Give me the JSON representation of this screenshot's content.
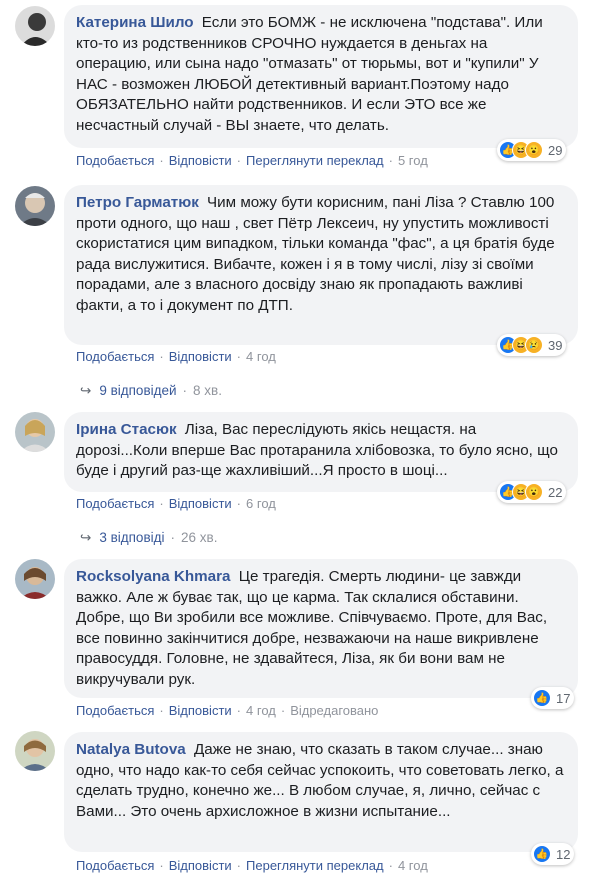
{
  "comments": [
    {
      "author": "Катерина Шило",
      "text": "Если это БОМЖ - не исключена \"подстава\". Или кто-то из родственников СРОЧНО нуждается в деньгах на операцию, или сына надо \"отмазать\" от тюрьмы, вот и \"купили\" У НАС - возможен ЛЮБОЙ детективный вариант.Поэтому надо ОБЯЗАТЕЛЬНО найти родственников. И если ЭТО все же несчастный случай - ВЫ знаете, что делать.",
      "like": "Подобається",
      "reply": "Відповісти",
      "translate": "Переглянути переклад",
      "time": "5 год",
      "reactions_count": "29",
      "reaction_icons": [
        "like-icon",
        "haha-icon",
        "wow-icon"
      ]
    },
    {
      "author": "Петро Гарматюк",
      "text": "Чим можу бути корисним, пані Ліза ? Ставлю 100 проти одного, що наш , свет Пётр Лексеич, ну упустить можливості скористатися цим випадком, тільки команда \"фас\", а ця братія буде рада вислужитися. Вибачте, кожен і я в тому числі, лізу зі своїми порадами, але з власного досвіду знаю як пропадають важливі факти, а то і документ по ДТП.",
      "like": "Подобається",
      "reply": "Відповісти",
      "time": "4 год",
      "reactions_count": "39",
      "reaction_icons": [
        "like-icon",
        "haha-icon",
        "sad-icon"
      ],
      "replies_label": "9 відповідей",
      "replies_time": "8 хв."
    },
    {
      "author": "Ірина Стасюк",
      "text": "Ліза, Вас переслідують якісь нещастя. на дорозі...Коли вперше Вас протаранила хлібовозка, то було ясно, що буде і другий раз-ще жахливіший...Я просто в шоці...",
      "like": "Подобається",
      "reply": "Відповісти",
      "time": "6 год",
      "reactions_count": "22",
      "reaction_icons": [
        "like-icon",
        "haha-icon",
        "wow-icon"
      ],
      "replies_label": "3 відповіді",
      "replies_time": "26 хв."
    },
    {
      "author": "Rocksolyana Khmara",
      "text": "Це трагедія. Смерть людини- це завжди важко. Але ж буває так, що це карма. Так склалися обставини. Добре, що Ви зробили все можливе. Співчуваємо. Проте, для Вас, все повинно закінчитися добре, незважаючи на наше викривлене правосуддя. Головне, не здавайтеся, Ліза, як би вони вам не викручували рук.",
      "like": "Подобається",
      "reply": "Відповісти",
      "time": "4 год",
      "edited": "Відредаговано",
      "reactions_count": "17",
      "reaction_icons": [
        "like-icon"
      ]
    },
    {
      "author": "Natalya Butova",
      "text": "Даже не знаю, что сказать в таком случае... знаю одно, что надо как-то себя сейчас успокоить, что советовать легко, а сделать трудно, конечно же... В любом случае, я, лично, сейчас с Вами... Это очень архисложное в жизни испытание...",
      "like": "Подобається",
      "reply": "Відповісти",
      "translate": "Переглянути переклад",
      "time": "4 год",
      "reactions_count": "12",
      "reaction_icons": [
        "like-icon"
      ]
    }
  ],
  "colors": {
    "link": "#385898",
    "bubble": "#f2f3f5",
    "meta": "#90949c",
    "like": "#1877f2",
    "emoji": "#f7b125"
  }
}
